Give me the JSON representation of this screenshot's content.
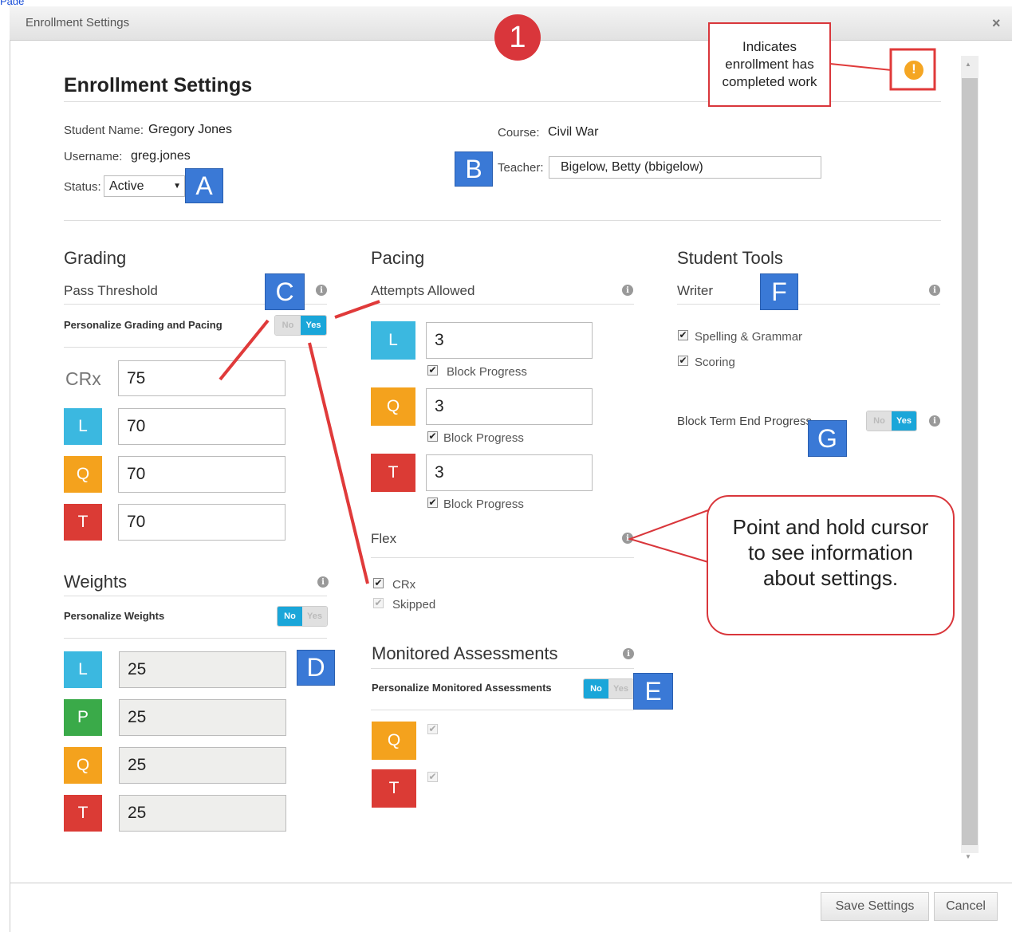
{
  "top_link": "Page",
  "window": {
    "title": "Enrollment Settings",
    "close": "×"
  },
  "heading": "Enrollment Settings",
  "student": {
    "name_label": "Student Name:",
    "name": "Gregory Jones",
    "username_label": "Username:",
    "username": "greg.jones",
    "status_label": "Status:",
    "status": "Active",
    "course_label": "Course:",
    "course": "Civil War",
    "teacher_label": "Teacher:",
    "teacher": "Bigelow, Betty (bbigelow)"
  },
  "grading": {
    "title": "Grading",
    "pass_threshold": "Pass Threshold",
    "personalize": "Personalize Grading and Pacing",
    "toggle_no": "No",
    "toggle_yes": "Yes",
    "toggle_value": "Yes",
    "rows": [
      {
        "label": "CRx",
        "value": "75"
      },
      {
        "label": "L",
        "value": "70",
        "color": "#3bb8e0"
      },
      {
        "label": "Q",
        "value": "70",
        "color": "#f4a21d"
      },
      {
        "label": "T",
        "value": "70",
        "color": "#db3b35"
      }
    ]
  },
  "weights": {
    "title": "Weights",
    "personalize": "Personalize Weights",
    "toggle_no": "No",
    "toggle_yes": "Yes",
    "toggle_value": "No",
    "rows": [
      {
        "label": "L",
        "value": "25",
        "color": "#3bb8e0"
      },
      {
        "label": "P",
        "value": "25",
        "color": "#3aaa49"
      },
      {
        "label": "Q",
        "value": "25",
        "color": "#f4a21d"
      },
      {
        "label": "T",
        "value": "25",
        "color": "#db3b35"
      }
    ]
  },
  "pacing": {
    "title": "Pacing",
    "attempts": "Attempts Allowed",
    "block_progress": "Block Progress",
    "rows": [
      {
        "label": "L",
        "value": "3",
        "color": "#3bb8e0",
        "block": true
      },
      {
        "label": "Q",
        "value": "3",
        "color": "#f4a21d",
        "block": true
      },
      {
        "label": "T",
        "value": "3",
        "color": "#db3b35",
        "block": true
      }
    ]
  },
  "flex": {
    "title": "Flex",
    "crx": "CRx",
    "skipped": "Skipped"
  },
  "monitored": {
    "title": "Monitored Assessments",
    "personalize": "Personalize Monitored Assessments",
    "toggle_no": "No",
    "toggle_yes": "Yes",
    "toggle_value": "No",
    "rows": [
      {
        "label": "Q",
        "color": "#f4a21d"
      },
      {
        "label": "T",
        "color": "#db3b35"
      }
    ]
  },
  "tools": {
    "title": "Student Tools",
    "writer": "Writer",
    "spelling": "Spelling & Grammar",
    "scoring": "Scoring",
    "block_term": "Block Term End Progress",
    "toggle_no": "No",
    "toggle_yes": "Yes",
    "toggle_value": "Yes"
  },
  "badges": {
    "A": "A",
    "B": "B",
    "C": "C",
    "D": "D",
    "E": "E",
    "F": "F",
    "G": "G"
  },
  "callouts": {
    "number": "1",
    "indicator": "Indicates enrollment has completed work",
    "hover": "Point and hold cursor to see information about settings.",
    "accent": "#d9363b",
    "warning_icon": "!"
  },
  "footer": {
    "save": "Save Settings",
    "cancel": "Cancel"
  },
  "colors": {
    "badge": "#3a79d6",
    "toggle_on": "#1aa6d9",
    "warning": "#f5a623"
  }
}
